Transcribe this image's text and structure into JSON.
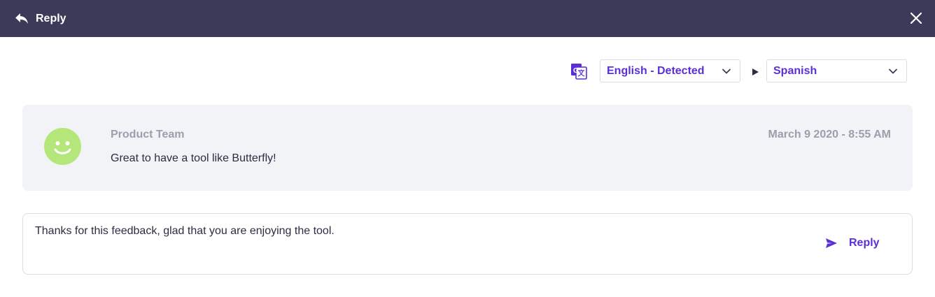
{
  "header": {
    "title": "Reply",
    "background": "#3b3a58"
  },
  "translation": {
    "source_language": "English - Detected",
    "target_language": "Spanish",
    "accent_color": "#5b2fd6"
  },
  "message": {
    "author": "Product Team",
    "timestamp": "March 9 2020 - 8:55 AM",
    "text": "Great to have a tool like Butterfly!",
    "avatar_color": "#b4e67a",
    "avatar_icon": "smiley-icon"
  },
  "reply": {
    "text": "Thanks for this feedback, glad that you are enjoying the tool.",
    "button_label": "Reply"
  }
}
